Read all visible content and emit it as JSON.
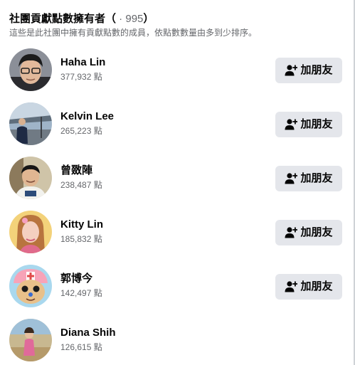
{
  "header": {
    "title": "社團貢獻點數擁有者（",
    "count": " · 995",
    "close_paren": "）",
    "subtitle": "這些是此社團中擁有貢獻點數的成員，依點數數量由多到少排序。"
  },
  "add_friend_label": "加朋友",
  "members": [
    {
      "name": "Haha Lin",
      "points": "377,932 點"
    },
    {
      "name": "Kelvin Lee",
      "points": "265,223 點"
    },
    {
      "name": "曾敪陣",
      "points": "238,487 點"
    },
    {
      "name": "Kitty Lin",
      "points": "185,832 點"
    },
    {
      "name": "郭博今",
      "points": "142,497 點"
    },
    {
      "name": "Diana Shih",
      "points": "126,615 點"
    }
  ],
  "icons": {
    "add_friend": "person-plus-icon",
    "avatar": "profile-photo"
  }
}
